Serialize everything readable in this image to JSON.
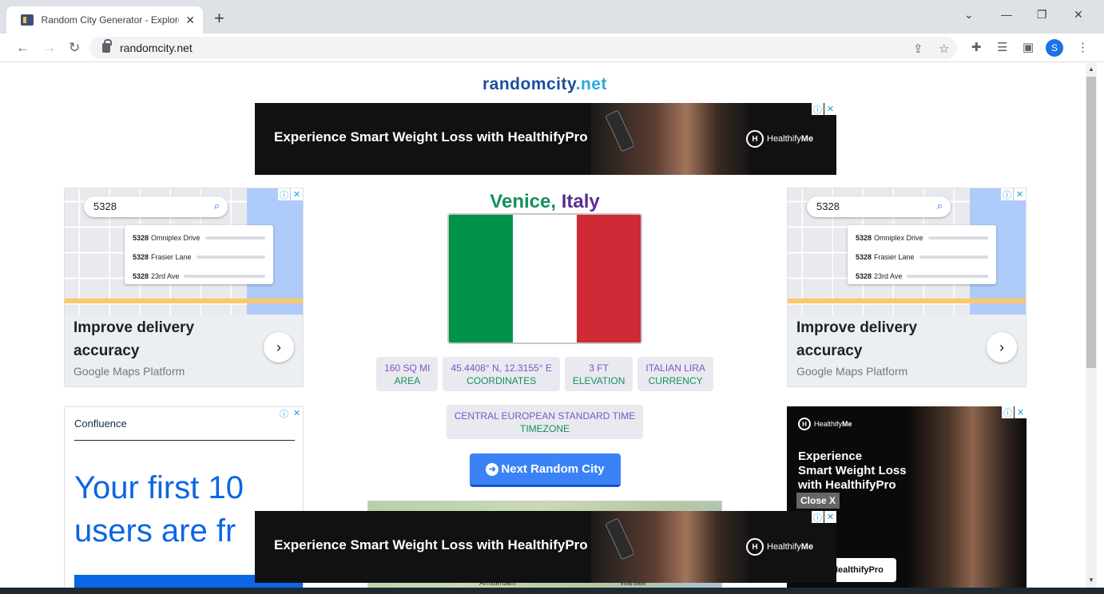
{
  "browser": {
    "tab_title": "Random City Generator - Explore",
    "tab_close": "✕",
    "new_tab": "+",
    "url": "randomcity.net",
    "profile_initial": "S",
    "window_controls": [
      "⌄",
      "—",
      "❐",
      "✕"
    ]
  },
  "page": {
    "logo_part1": "randomcity",
    "logo_part2": ".net",
    "city": "Venice,",
    "country": "Italy",
    "flag_colors": [
      "#009246",
      "#ffffff",
      "#ce2b37"
    ],
    "stats": [
      {
        "value": "160 SQ MI",
        "label": "AREA"
      },
      {
        "value": "45.4408° N, 12.3155° E",
        "label": "COORDINATES"
      },
      {
        "value": "3 FT",
        "label": "ELEVATION"
      },
      {
        "value": "ITALIAN LIRA",
        "label": "CURRENCY"
      }
    ],
    "timezone": {
      "value": "CENTRAL EUROPEAN STANDARD TIME",
      "label": "TIMEZONE"
    },
    "next_button": "Next Random City",
    "map_labels": [
      "Amsterdam",
      "Warsaw"
    ]
  },
  "ads": {
    "banner_text": "Experience Smart Weight Loss with HealthifyPro",
    "brand_prefix": "Healthify",
    "brand_suffix": "Me",
    "maps_ad": {
      "search_value": "5328",
      "suggestions": [
        {
          "num": "5328",
          "street": "Omniplex Drive"
        },
        {
          "num": "5328",
          "street": "Frasier Lane"
        },
        {
          "num": "5328",
          "street": "23rd Ave"
        }
      ],
      "headline_line1": "Improve delivery",
      "headline_line2": "accuracy",
      "advertiser": "Google Maps Platform"
    },
    "confluence_ad": {
      "brand": "Confluence",
      "headline_line1": "Your first 10",
      "headline_line2": "users are fr"
    },
    "healthify_ad": {
      "line1": "Experience",
      "line2": "Smart Weight Loss",
      "line3": "with HealthifyPro",
      "close_label": "Close X",
      "cta": "HealthifyPro"
    }
  }
}
